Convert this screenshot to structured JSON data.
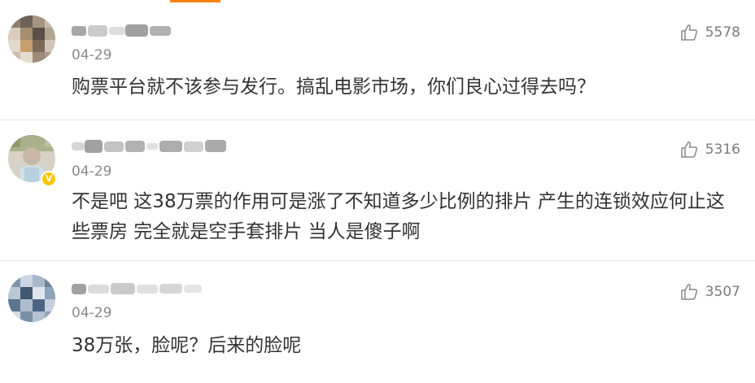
{
  "comments": [
    {
      "date": "04-29",
      "text": "购票平台就不该参与发行。搞乱电影市场，你们良心过得去吗？",
      "likes": "5578",
      "verified": false
    },
    {
      "date": "04-29",
      "text": "不是吧 这38万票的作用可是涨了不知道多少比例的排片 产生的连锁效应何止这些票房 完全就是空手套排片 当人是傻子啊",
      "likes": "5316",
      "verified": true
    },
    {
      "date": "04-29",
      "text": "38万张，脸呢？后来的脸呢",
      "likes": "3507",
      "verified": false
    }
  ],
  "icons": {
    "like": "thumbs-up-icon",
    "verified": "verified-badge-icon"
  },
  "colors": {
    "accent": "#ff8200",
    "text": "#333333",
    "meta": "#8a8a8a",
    "verified": "#ffc500",
    "divider": "#e6e6e6"
  }
}
